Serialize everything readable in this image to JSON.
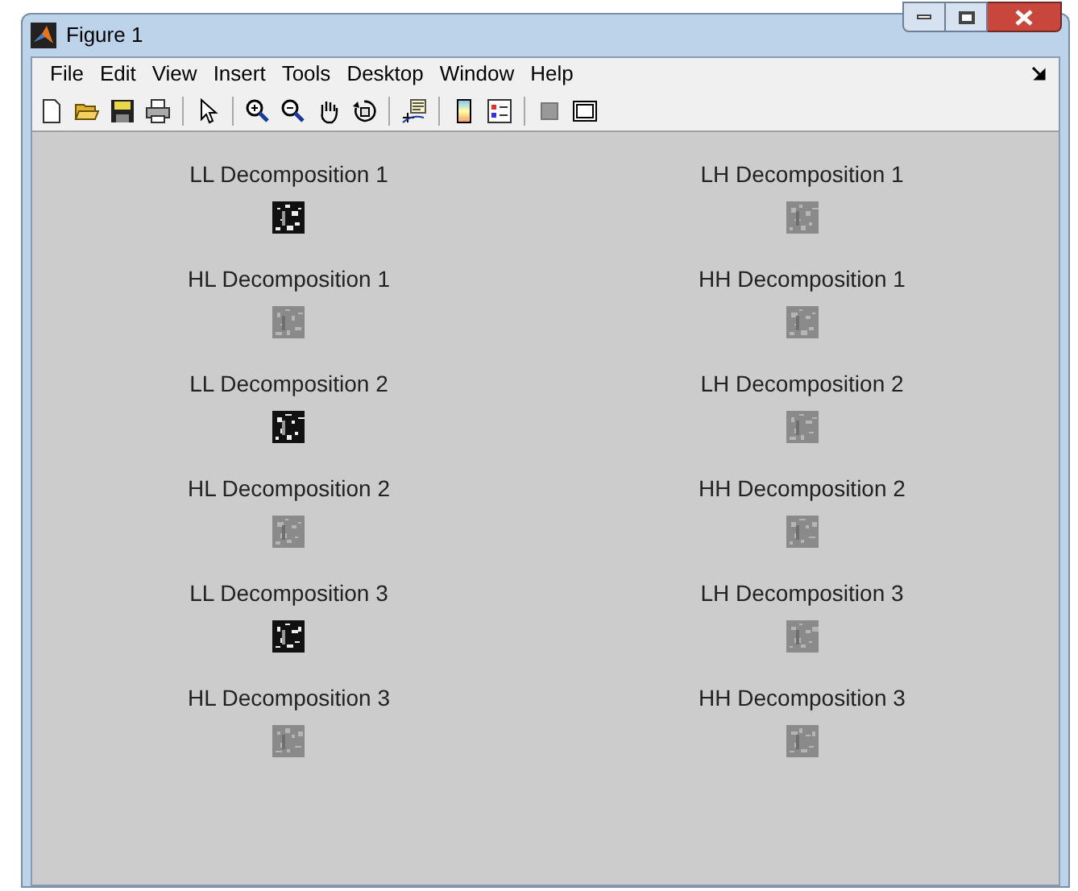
{
  "window": {
    "title": "Figure 1"
  },
  "menu": [
    "File",
    "Edit",
    "View",
    "Insert",
    "Tools",
    "Desktop",
    "Window",
    "Help"
  ],
  "plots": [
    {
      "title": "LL Decomposition 1",
      "kind": "dark"
    },
    {
      "title": "LH Decomposition 1",
      "kind": "gray"
    },
    {
      "title": "HL Decomposition 1",
      "kind": "gray"
    },
    {
      "title": "HH Decomposition 1",
      "kind": "gray"
    },
    {
      "title": "LL Decomposition 2",
      "kind": "dark"
    },
    {
      "title": "LH Decomposition 2",
      "kind": "gray"
    },
    {
      "title": "HL Decomposition 2",
      "kind": "gray"
    },
    {
      "title": "HH Decomposition 2",
      "kind": "gray"
    },
    {
      "title": "LL Decomposition 3",
      "kind": "dark"
    },
    {
      "title": "LH Decomposition 3",
      "kind": "gray"
    },
    {
      "title": "HL Decomposition 3",
      "kind": "gray"
    },
    {
      "title": "HH Decomposition 3",
      "kind": "gray"
    }
  ]
}
